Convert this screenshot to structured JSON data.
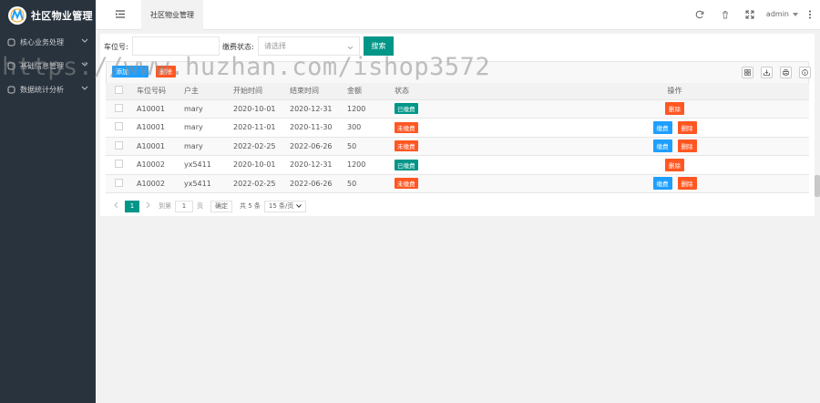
{
  "app": {
    "title": "社区物业管理"
  },
  "sidebar": {
    "items": [
      {
        "label": "核心业务处理"
      },
      {
        "label": "基础信息管理"
      },
      {
        "label": "数据统计分析"
      }
    ]
  },
  "header": {
    "tab_label": "社区物业管理",
    "user": "admin"
  },
  "search": {
    "plate_label": "车位号:",
    "plate_value": "",
    "status_label": "缴费状态:",
    "status_placeholder": "请选择",
    "search_button": "搜索"
  },
  "toolbar": {
    "btn1_label": "添加",
    "btn2_label": "删除"
  },
  "table": {
    "headers": [
      "车位号码",
      "户主",
      "开始时间",
      "结束时间",
      "金额",
      "状态",
      "操作"
    ],
    "rows": [
      {
        "plate": "A10001",
        "owner": "mary",
        "start": "2020-10-01",
        "end": "2020-12-31",
        "amount": "1200",
        "status": "已缴费",
        "pay": "",
        "del": "删除"
      },
      {
        "plate": "A10001",
        "owner": "mary",
        "start": "2020-11-01",
        "end": "2020-11-30",
        "amount": "300",
        "status": "未缴费",
        "pay": "缴费",
        "del": "删除"
      },
      {
        "plate": "A10001",
        "owner": "mary",
        "start": "2022-02-25",
        "end": "2022-06-26",
        "amount": "50",
        "status": "未缴费",
        "pay": "缴费",
        "del": "删除"
      },
      {
        "plate": "A10002",
        "owner": "yx5411",
        "start": "2020-10-01",
        "end": "2020-12-31",
        "amount": "1200",
        "status": "已缴费",
        "pay": "",
        "del": "删除"
      },
      {
        "plate": "A10002",
        "owner": "yx5411",
        "start": "2022-02-25",
        "end": "2022-06-26",
        "amount": "50",
        "status": "未缴费",
        "pay": "缴费",
        "del": "删除"
      }
    ]
  },
  "pager": {
    "current": "1",
    "goto_label": "到第",
    "goto_value": "1",
    "page_unit": "页",
    "confirm": "确定",
    "total": "共 5 条",
    "per_page": "15 条/页"
  },
  "watermark": "https://www.huzhan.com/ishop3572",
  "colors": {
    "sidebar_bg": "#28333e",
    "primary": "#009688",
    "danger": "#ff5722",
    "info": "#1e9fff"
  }
}
